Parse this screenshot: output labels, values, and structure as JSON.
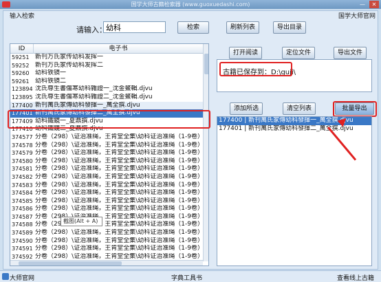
{
  "window": {
    "title": "国学大师古籍检索器 (www.guoxuedashi.com)",
    "minimize_glyph": "—",
    "close_glyph": "✕"
  },
  "search_group": {
    "group_label": "输入检索",
    "site_label": "国学大师官网",
    "input_label": "请输入：",
    "input_value": "幼科",
    "search_button": "检索",
    "refresh_button": "刷新列表",
    "export_dir_button": "导出目录"
  },
  "results": {
    "header_id": "ID",
    "header_book": "电子书",
    "rows": [
      {
        "id": "59251",
        "book": "新刊万氏家传幼科发挥一"
      },
      {
        "id": "59252",
        "book": "新刊万氏家传幼科发挥二"
      },
      {
        "id": "59260",
        "book": "幼科铁镜一"
      },
      {
        "id": "59261",
        "book": "幼科铁镜二"
      },
      {
        "id": "123894",
        "book": "沈氏尊生書傷寒幼科雜證一_沈金鰲輯.djvu"
      },
      {
        "id": "123895",
        "book": "沈氏尊生書傷寒幼科雜證二_沈金鰲輯.djvu"
      },
      {
        "id": "177400",
        "book": "新刊萬氏家傳幼科發揮一_萬全撰.djvu"
      },
      {
        "id": "177401",
        "book": "新刊萬氏家傳幼科發揮二_萬全撰.djvu"
      },
      {
        "id": "177409",
        "book": "幼科鐵鏡一_夏鼎撰.djvu"
      },
      {
        "id": "177410",
        "book": "幼科鐵鏡二_夏鼎撰.djvu"
      },
      {
        "id": "374577",
        "book": "分卷（298）\\证治准绳，王肯堂全集\\幼科证治准绳（1-9卷）\\幼科证"
      },
      {
        "id": "374578",
        "book": "分卷（298）\\证治准绳，王肯堂全集\\幼科证治准绳（1-9卷）\\幼科证"
      },
      {
        "id": "374579",
        "book": "分卷（298）\\证治准绳，王肯堂全集\\幼科证治准绳（1-9卷）\\幼科证"
      },
      {
        "id": "374580",
        "book": "分卷（298）\\证治准绳，王肯堂全集\\幼科证治准绳（1-9卷）\\幼科证"
      },
      {
        "id": "374581",
        "book": "分卷（298）\\证治准绳，王肯堂全集\\幼科证治准绳（1-9卷）\\幼科证"
      },
      {
        "id": "374582",
        "book": "分卷（298）\\证治准绳，王肯堂全集\\幼科证治准绳（1-9卷）\\幼科证"
      },
      {
        "id": "374583",
        "book": "分卷（298）\\证治准绳，王肯堂全集\\幼科证治准绳（1-9卷）\\幼科证"
      },
      {
        "id": "374584",
        "book": "分卷（298）\\证治准绳，王肯堂全集\\幼科证治准绳（1-9卷）\\幼科证"
      },
      {
        "id": "374585",
        "book": "分卷（298）\\证治准绳，王肯堂全集\\幼科证治准绳（1-9卷）\\幼科证"
      },
      {
        "id": "374586",
        "book": "分卷（298）\\证治准绳，王肯堂全集\\幼科证治准绳（1-9卷）\\幼科证"
      },
      {
        "id": "374587",
        "book": "分卷（298）\\证治准绳，王肯堂全集\\幼科证治准绳（1-9卷）\\幼科证"
      },
      {
        "id": "374588",
        "book": "分卷（298）\\证治准绳，王肯堂全集\\幼科证治准绳（1-9卷）\\幼科证"
      },
      {
        "id": "374589",
        "book": "分卷（298）\\证治准绳，王肯堂全集\\幼科证治准绳（1-9卷）\\幼科证"
      },
      {
        "id": "374590",
        "book": "分卷（298）\\证治准绳，王肯堂全集\\幼科证治准绳（1-9卷）\\幼科证"
      },
      {
        "id": "374591",
        "book": "分卷（298）\\证治准绳，王肯堂全集\\幼科证治准绳（1-9卷）\\幼科证"
      },
      {
        "id": "374592",
        "book": "分卷（298）\\证治准绳，王肯堂全集\\幼科证治准绳（1-9卷）\\幼科证"
      }
    ]
  },
  "actions": {
    "open_read_button": "打开阅读",
    "locate_file_button": "定位文件",
    "export_file_button": "导出文件"
  },
  "save_path": {
    "label": "古籍已保存到：D:\\guji\\"
  },
  "batch": {
    "add_selected_button": "添加所选",
    "clear_list_button": "清空列表",
    "batch_export_button": "批量导出",
    "items": [
      "177400 | 新刊萬氏家傳幼科發揮一_萬全撰.djvu",
      "177401 | 新刊萬氏家傳幼科發揮二_萬全撰.djvu"
    ]
  },
  "tooltip": {
    "text": "截图(Alt + A)"
  },
  "status": {
    "left": "大师官网",
    "middle": "字典工具书",
    "right": "查看线上古籍"
  },
  "colors": {
    "accent_red": "#e02020",
    "selection_blue": "#3a78c6"
  }
}
